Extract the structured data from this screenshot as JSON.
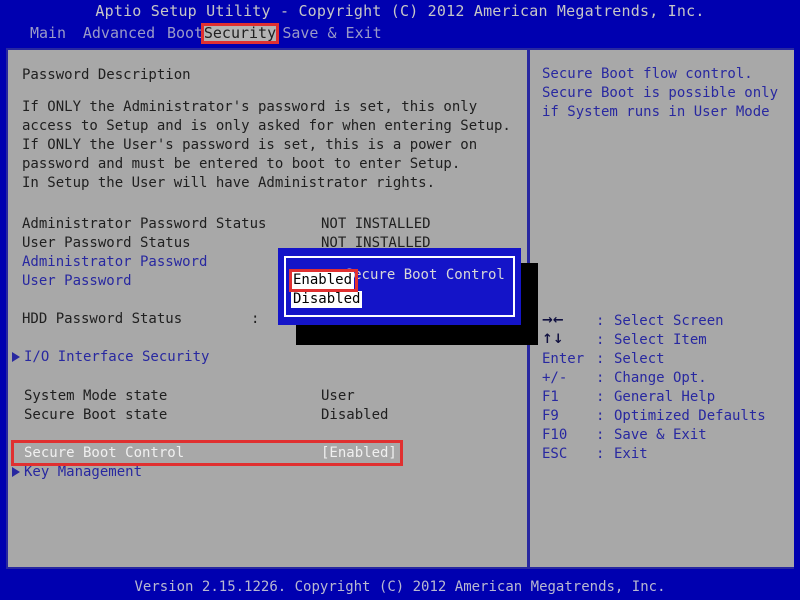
{
  "header": {
    "title": "Aptio Setup Utility - Copyright (C) 2012 American Megatrends, Inc."
  },
  "menu": {
    "items": [
      {
        "label": "Main",
        "selected": false
      },
      {
        "label": "Advanced",
        "selected": false
      },
      {
        "label": "Boot",
        "selected": false
      },
      {
        "label": "Security",
        "selected": true
      },
      {
        "label": "Save & Exit",
        "selected": false
      }
    ]
  },
  "main": {
    "section_title": "Password Description",
    "description_lines": [
      "If ONLY the Administrator's password is set, this only",
      "access to Setup and is only asked for when entering Setup.",
      "If ONLY the User's password is set, this is a power on",
      "password and must be entered to boot to enter Setup.",
      "In Setup the User will have Administrator rights."
    ],
    "status_rows": [
      {
        "label": "Administrator Password Status",
        "value": "NOT INSTALLED"
      },
      {
        "label": "User Password Status",
        "value": "NOT INSTALLED"
      }
    ],
    "password_links": [
      {
        "label": "Administrator Password"
      },
      {
        "label": "User Password"
      }
    ],
    "hdd_row": {
      "label": "HDD Password Status",
      "value": ":"
    },
    "submenu_io": {
      "label": "I/O Interface Security",
      "marker": "triangle-right-icon"
    },
    "state_rows": [
      {
        "label": "System Mode state",
        "value": "User"
      },
      {
        "label": "Secure Boot state",
        "value": "Disabled"
      }
    ],
    "selected_row": {
      "label": "Secure Boot Control",
      "value": "[Enabled]"
    },
    "submenu_key": {
      "label": "Key Management",
      "marker": "triangle-right-icon"
    }
  },
  "popup": {
    "title": "Secure Boot Control",
    "options": [
      {
        "label": "Enabled",
        "highlighted": true
      },
      {
        "label": "Disabled",
        "highlighted": false
      }
    ]
  },
  "help": {
    "text_lines": [
      "Secure Boot flow control.",
      "Secure Boot is possible only",
      "if System runs in User Mode"
    ],
    "legend": [
      {
        "key": "→←",
        "is_glyph": true,
        "colon": ":",
        "desc": "Select Screen"
      },
      {
        "key": "↑↓",
        "is_glyph": true,
        "colon": ":",
        "desc": "Select Item"
      },
      {
        "key": "Enter",
        "is_glyph": false,
        "colon": ":",
        "desc": "Select"
      },
      {
        "key": "+/-",
        "is_glyph": false,
        "colon": ":",
        "desc": "Change Opt."
      },
      {
        "key": "F1",
        "is_glyph": false,
        "colon": ":",
        "desc": "General Help"
      },
      {
        "key": "F9",
        "is_glyph": false,
        "colon": ":",
        "desc": "Optimized Defaults"
      },
      {
        "key": "F10",
        "is_glyph": false,
        "colon": ":",
        "desc": "Save & Exit"
      },
      {
        "key": "ESC",
        "is_glyph": false,
        "colon": ":",
        "desc": "Exit"
      }
    ]
  },
  "footer": {
    "version": "Version 2.15.1226. Copyright (C) 2012 American Megatrends, Inc."
  },
  "colors": {
    "screen_blue": "#0000b0",
    "panel_gray": "#a8a8a8",
    "border_blue": "#2828a0",
    "popup_blue": "#1414c8",
    "annotation_red": "#e03030",
    "menu_selected_bg": "#b4b4b4"
  }
}
